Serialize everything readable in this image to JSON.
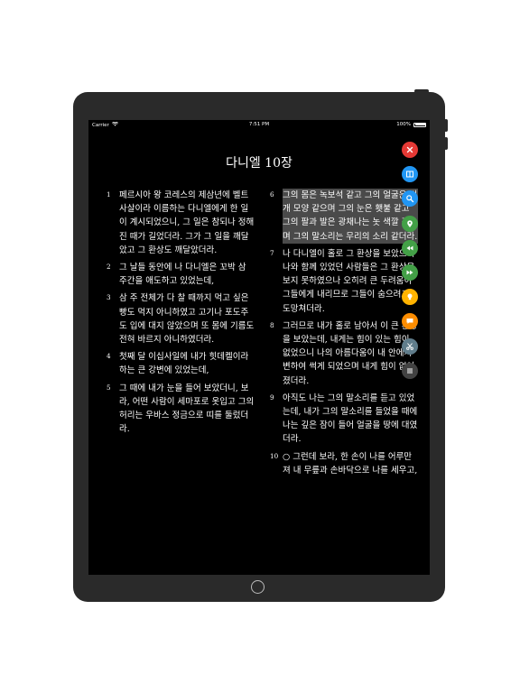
{
  "status_bar": {
    "carrier": "Carrier",
    "time": "7:51 PM",
    "battery": "100%",
    "battery_level": 1.0
  },
  "title": "다니엘 10장",
  "verses_left": [
    {
      "num": "1",
      "text": "페르시아 왕 코레스의 제삼년에 벨트사살이라 이름하는 다니엘에게 한 일이 계시되었으니, 그 일은 참되나 정해진 때가 길었더라. 그가 그 일을 깨달았고 그 환상도 깨달았더라.",
      "highlighted": false
    },
    {
      "num": "2",
      "text": "그 날들 동안에 나 다니엘은 꼬박 삼 주간을 애도하고 있었는데,",
      "highlighted": false
    },
    {
      "num": "3",
      "text": "삼 주 전체가 다 찰 때까지 먹고 싶은 빵도 먹지 아니하였고 고기나 포도주도 입에 대지 않았으며 또 몸에 기름도 전혀 바르지 아니하였더라.",
      "highlighted": false
    },
    {
      "num": "4",
      "text": "첫째 달 이십사일에 내가 힛데켈이라 하는 큰 강변에 있었는데,",
      "highlighted": false
    },
    {
      "num": "5",
      "text": "그 때에 내가 눈을 들어 보았더니, 보라, 어떤 사람이 세마포로 옷입고 그의 허리는 우바스 정금으로 띠를 둘렀더라.",
      "highlighted": false
    }
  ],
  "verses_right": [
    {
      "num": "6",
      "text": "그의 몸은 녹보석 같고 그의 얼굴은 번개 모양 같으며 그의 눈은 횃불 같고 그의 팔과 발은 광채나는 놋 색깔 같으며 그의 말소리는 무리의 소리 같더라.",
      "highlighted": true
    },
    {
      "num": "7",
      "text": "나 다니엘이 홀로 그 환상을 보았으며 나와 함께 있었던 사람들은 그 환상을 보지 못하였으나 오히려 큰 두려움이 그들에게 내리므로 그들이 숨으려고 도망쳐더라.",
      "highlighted": false
    },
    {
      "num": "8",
      "text": "그러므로 내가 홀로 남아서 이 큰 환상을 보았는데, 내게는 힘이 있는 힘이 없었으니 나의 아름다움이 내 안에서 변하여 썩게 되었으며 내게 힘이 없어졌더라.",
      "highlighted": false
    },
    {
      "num": "9",
      "text": "아직도 나는 그의 말소리를 듣고 있었는데, 내가 그의 말소리를 들었을 때에 나는 깊은 잠이 들어 얼굴을 땅에 대였더라.",
      "highlighted": false
    },
    {
      "num": "10",
      "text": "○ 그런데 보라, 한 손이 나를 어루만져 내 무릎과 손바닥으로 나를 세우고,",
      "highlighted": false
    }
  ],
  "toolbar": [
    {
      "name": "close-icon",
      "color": "#e53935"
    },
    {
      "name": "book-icon",
      "color": "#2196f3"
    },
    {
      "name": "search-icon",
      "color": "#2196f3"
    },
    {
      "name": "location-pin-icon",
      "color": "#43a047"
    },
    {
      "name": "rewind-icon",
      "color": "#43a047"
    },
    {
      "name": "fast-forward-icon",
      "color": "#43a047"
    },
    {
      "name": "lightbulb-icon",
      "color": "#ffb300"
    },
    {
      "name": "comment-icon",
      "color": "#fb8c00"
    },
    {
      "name": "scissors-icon",
      "color": "#607d8b"
    },
    {
      "name": "menu-icon",
      "color": "#424242"
    }
  ]
}
